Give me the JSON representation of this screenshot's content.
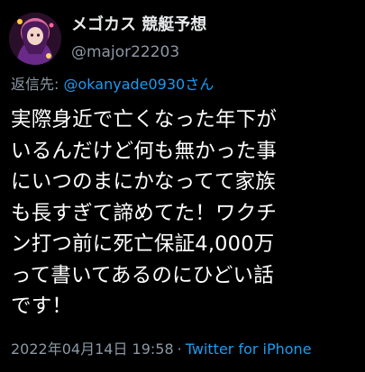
{
  "user": {
    "display_name": "メゴカス 競艇予想",
    "handle": "@major22203",
    "avatar_icon": "user-avatar-icon"
  },
  "reply": {
    "label": "返信先:",
    "to": "@okanyade0930さん"
  },
  "tweet": {
    "lines": [
      "実際身近で亡くなった年下が",
      "いるんだけど何も無かった事",
      "にいつのまにかなってて家族",
      "も長すぎて諦めてた！ワクチ",
      "ン打つ前に死亡保証4,000万",
      "って書いてあるのにひどい話",
      "です！"
    ]
  },
  "meta": {
    "timestamp": "2022年04月14日 19:58",
    "separator": "·",
    "source": "Twitter for iPhone"
  },
  "colors": {
    "background": "#000000",
    "text": "#ffffff",
    "secondary": "#8b98a5",
    "link": "#1d9bf0"
  }
}
